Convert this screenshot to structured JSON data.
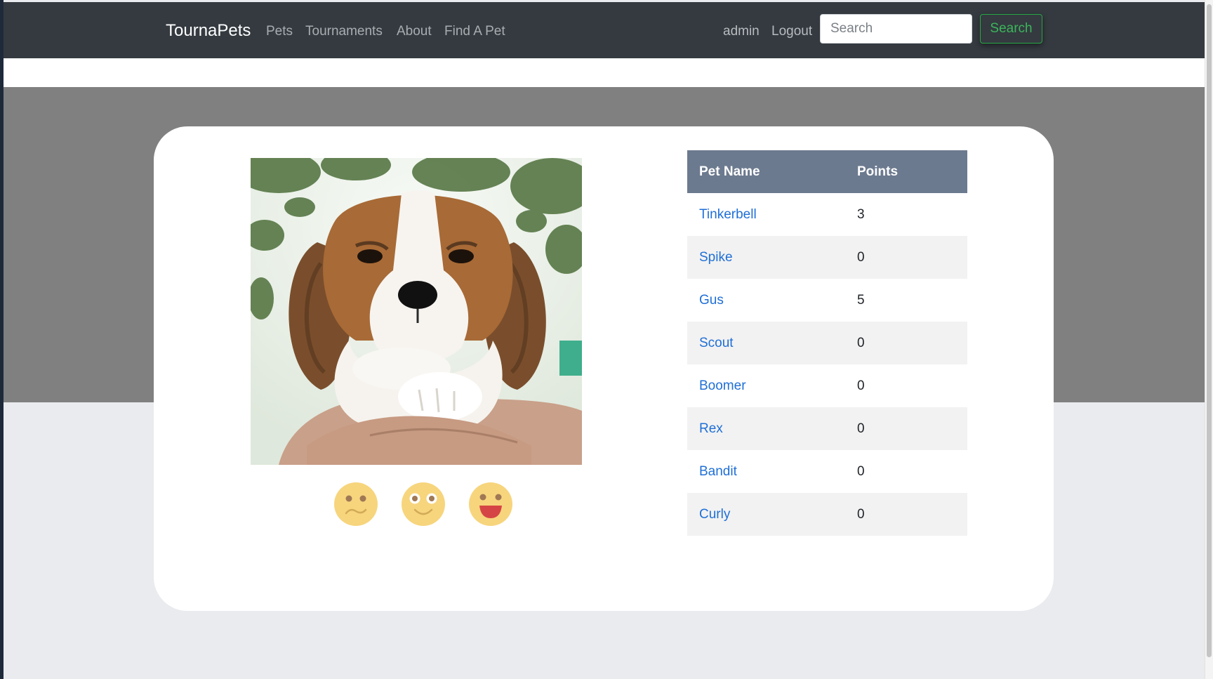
{
  "navbar": {
    "brand": "TournaPets",
    "links": [
      "Pets",
      "Tournaments",
      "About",
      "Find A Pet"
    ],
    "user": "admin",
    "logout": "Logout",
    "search_placeholder": "Search",
    "search_button": "Search"
  },
  "voting": {
    "photo_icon": "beagle-puppy-photo",
    "buttons": [
      {
        "name": "sad-face-icon"
      },
      {
        "name": "smile-face-icon"
      },
      {
        "name": "laugh-face-icon"
      }
    ]
  },
  "table": {
    "headers": [
      "Pet Name",
      "Points"
    ],
    "rows": [
      {
        "name": "Tinkerbell",
        "points": "3"
      },
      {
        "name": "Spike",
        "points": "0"
      },
      {
        "name": "Gus",
        "points": "5"
      },
      {
        "name": "Scout",
        "points": "0"
      },
      {
        "name": "Boomer",
        "points": "0"
      },
      {
        "name": "Rex",
        "points": "0"
      },
      {
        "name": "Bandit",
        "points": "0"
      },
      {
        "name": "Curly",
        "points": "0"
      }
    ]
  },
  "colors": {
    "navbar_bg": "#343a40",
    "header_row": "#6c7a8f",
    "link": "#1f6fd6",
    "search_button": "#28a745",
    "emoji_face": "#f7d57d"
  }
}
